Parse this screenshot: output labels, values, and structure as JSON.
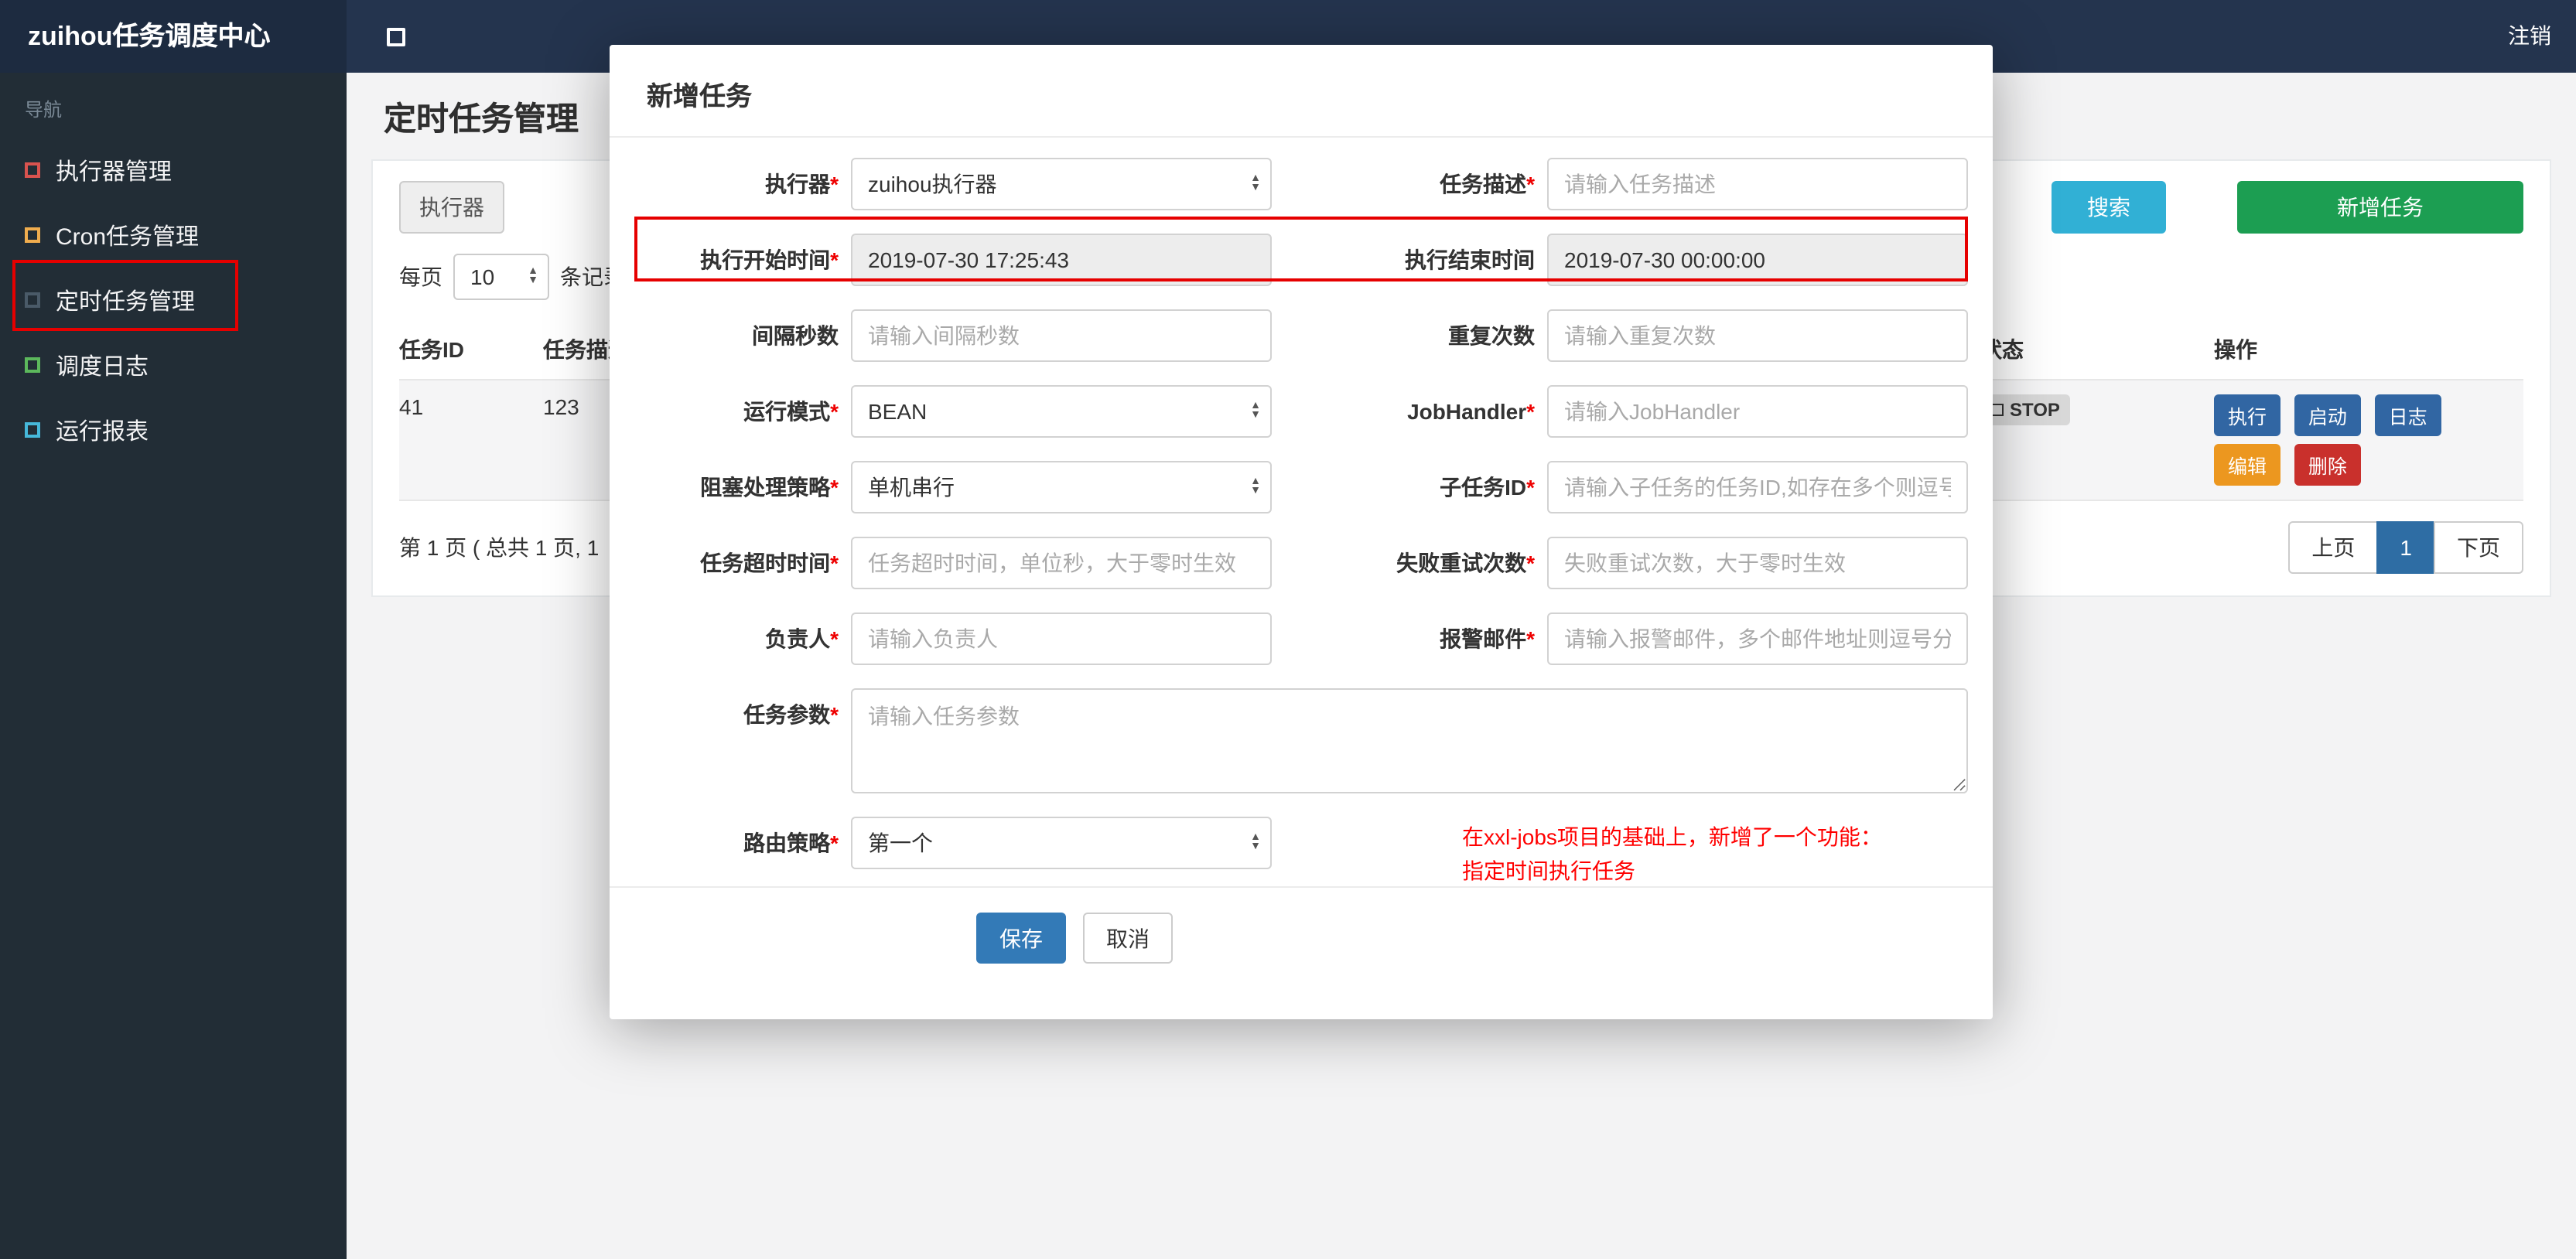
{
  "colors": {
    "search_button": "#31b0d5",
    "add_button": "#1c9e52",
    "primary_button": "#337ab7",
    "active_page": "#2e6da4",
    "annotation": "#e60000",
    "note_text": "#ff0000",
    "status_badge_bg": "#d8d8d8"
  },
  "topbar": {
    "brand": "zuihou任务调度中心",
    "logout": "注销"
  },
  "sidebar": {
    "nav_label": "导航",
    "items": [
      {
        "label": "执行器管理",
        "color": "#d9534f"
      },
      {
        "label": "Cron任务管理",
        "color": "#f0ad4e"
      },
      {
        "label": "定时任务管理",
        "color": "#4a5a68"
      },
      {
        "label": "调度日志",
        "color": "#5cb85c"
      },
      {
        "label": "运行报表",
        "color": "#46b8da"
      }
    ]
  },
  "page": {
    "title": "定时任务管理",
    "filter": {
      "executor_addon": "执行器",
      "search_button": "搜索",
      "add_button": "新增任务"
    },
    "per_page": {
      "prefix": "每页",
      "value": "10",
      "suffix": "条记录"
    },
    "table": {
      "headers": {
        "id": "任务ID",
        "desc": "任务描述",
        "status": "状态",
        "actions": "操作"
      },
      "row": {
        "id": "41",
        "desc": "123",
        "status": "STOP",
        "actions": [
          {
            "label": "执行",
            "color": "#3166a3"
          },
          {
            "label": "启动",
            "color": "#3166a3"
          },
          {
            "label": "日志",
            "color": "#3166a3"
          },
          {
            "label": "编辑",
            "color": "#ec971f"
          },
          {
            "label": "删除",
            "color": "#c9302c"
          }
        ]
      }
    },
    "pagination": {
      "info": "第 1 页 ( 总共 1 页, 1",
      "prev": "上页",
      "current": "1",
      "next": "下页"
    }
  },
  "modal": {
    "title": "新增任务",
    "executor": {
      "label": "执行器",
      "required": "*",
      "value": "zuihou执行器"
    },
    "job_desc": {
      "label": "任务描述",
      "required": "*",
      "placeholder": "请输入任务描述"
    },
    "start_time": {
      "label": "执行开始时间",
      "required": "*",
      "value": "2019-07-30 17:25:43"
    },
    "end_time": {
      "label": "执行结束时间",
      "value": "2019-07-30 00:00:00"
    },
    "interval": {
      "label": "间隔秒数",
      "placeholder": "请输入间隔秒数"
    },
    "repeat_count": {
      "label": "重复次数",
      "placeholder": "请输入重复次数"
    },
    "run_mode": {
      "label": "运行模式",
      "required": "*",
      "value": "BEAN"
    },
    "job_handler": {
      "label": "JobHandler",
      "required": "*",
      "placeholder": "请输入JobHandler"
    },
    "block_strategy": {
      "label": "阻塞处理策略",
      "required": "*",
      "value": "单机串行"
    },
    "child_job": {
      "label": "子任务ID",
      "required": "*",
      "placeholder": "请输入子任务的任务ID,如存在多个则逗号分隔"
    },
    "timeout": {
      "label": "任务超时时间",
      "required": "*",
      "placeholder": "任务超时时间，单位秒，大于零时生效"
    },
    "retry": {
      "label": "失败重试次数",
      "required": "*",
      "placeholder": "失败重试次数，大于零时生效"
    },
    "owner": {
      "label": "负责人",
      "required": "*",
      "placeholder": "请输入负责人"
    },
    "alarm_email": {
      "label": "报警邮件",
      "required": "*",
      "placeholder": "请输入报警邮件，多个邮件地址则逗号分隔"
    },
    "job_param": {
      "label": "任务参数",
      "required": "*",
      "placeholder": "请输入任务参数"
    },
    "route_strategy": {
      "label": "路由策略",
      "required": "*",
      "value": "第一个"
    },
    "note_line1": "在xxl-jobs项目的基础上，新增了一个功能：",
    "note_line2": "指定时间执行任务",
    "save_button": "保存",
    "cancel_button": "取消"
  }
}
